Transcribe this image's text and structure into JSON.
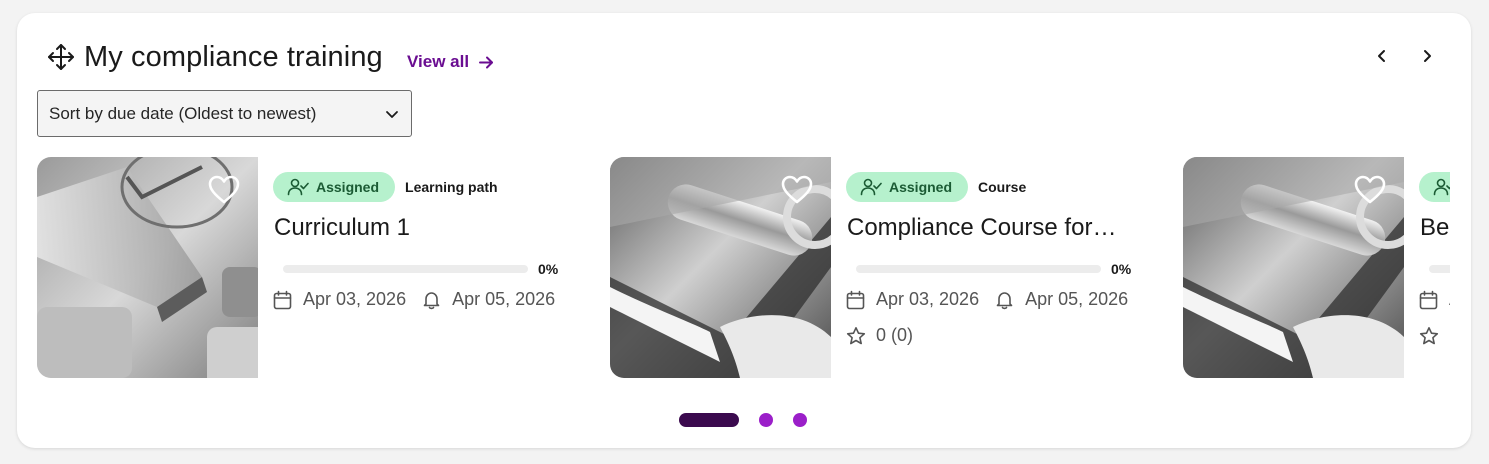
{
  "section": {
    "title": "My compliance training",
    "view_all": "View all"
  },
  "sort": {
    "selected": "Sort by due date (Oldest to newest)"
  },
  "colors": {
    "accent": "#6a0d91",
    "badge_bg": "#b6f1cd",
    "badge_text": "#1b5b34",
    "dot_active": "#3b0a4e",
    "dot": "#9b1fc9"
  },
  "cards": [
    {
      "status": "Assigned",
      "type": "Learning path",
      "title": "Curriculum 1",
      "progress": "0%",
      "progress_value": 0,
      "start_date": "Apr 03, 2026",
      "due_date": "Apr 05, 2026",
      "rating": ""
    },
    {
      "status": "Assigned",
      "type": "Course",
      "title": "Compliance Course for…",
      "progress": "0%",
      "progress_value": 0,
      "start_date": "Apr 03, 2026",
      "due_date": "Apr 05, 2026",
      "rating": "0 (0)"
    },
    {
      "status": "",
      "type": "",
      "title": "Be",
      "progress": "",
      "progress_value": 0,
      "start_date": "A",
      "due_date": "",
      "rating": "("
    }
  ],
  "icons": {
    "section": "move-icon",
    "prev": "chevron-left-icon",
    "next": "chevron-right-icon",
    "favorite": "heart-icon",
    "status": "user-check-icon",
    "date": "calendar-icon",
    "due": "bell-icon",
    "rating": "star-icon",
    "view_all": "arrow-right-icon",
    "sort": "chevron-down-icon"
  },
  "pagination": {
    "pages": 3,
    "current": 1
  }
}
